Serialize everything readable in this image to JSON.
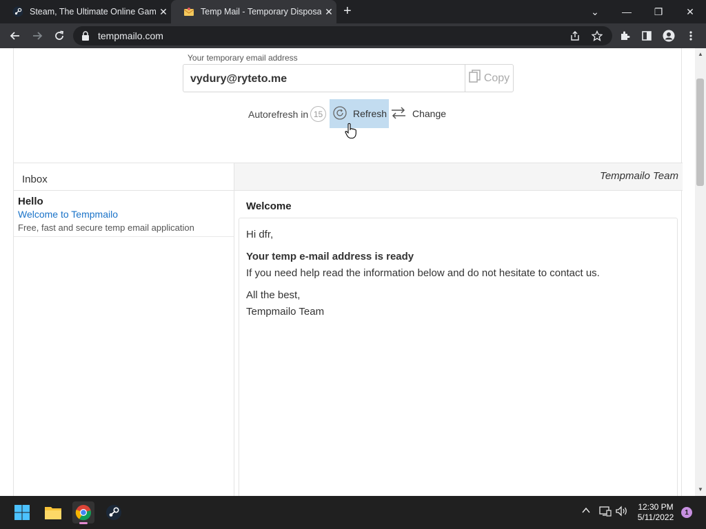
{
  "browser": {
    "tabs": [
      {
        "title": "Steam, The Ultimate Online Game Platform",
        "close": "✕"
      },
      {
        "title": "Temp Mail - Temporary Disposable Email",
        "close": "✕"
      }
    ],
    "new_tab": "+",
    "url": "tempmailo.com",
    "window_controls": [
      "⌄",
      "—",
      "❐",
      "✕"
    ]
  },
  "page": {
    "address_label": "Your temporary email address",
    "address": "vydury@ryteto.me",
    "copy_label": "Copy",
    "autorefresh_label": "Autorefresh in",
    "countdown": "15",
    "refresh_label": "Refresh",
    "change_label": "Change",
    "inbox_title": "Inbox",
    "messages": [
      {
        "from": "Hello",
        "subject": "Welcome to Tempmailo",
        "preview": "Free, fast and secure temp email application"
      }
    ],
    "reader": {
      "sender": "Tempmailo Team",
      "subject": "Welcome",
      "greeting": "Hi dfr,",
      "headline": "Your temp e-mail address is ready",
      "body": "If you need help read the information below and do not hesitate to contact us.",
      "signoff": "All the best,",
      "signature": "Tempmailo Team"
    }
  },
  "taskbar": {
    "time": "12:30 PM",
    "date": "5/11/2022",
    "notifications": "1"
  },
  "colors": {
    "refresh_highlight": "#c2dcf0",
    "link": "#1a73c8",
    "chrome_dark": "#202124"
  }
}
